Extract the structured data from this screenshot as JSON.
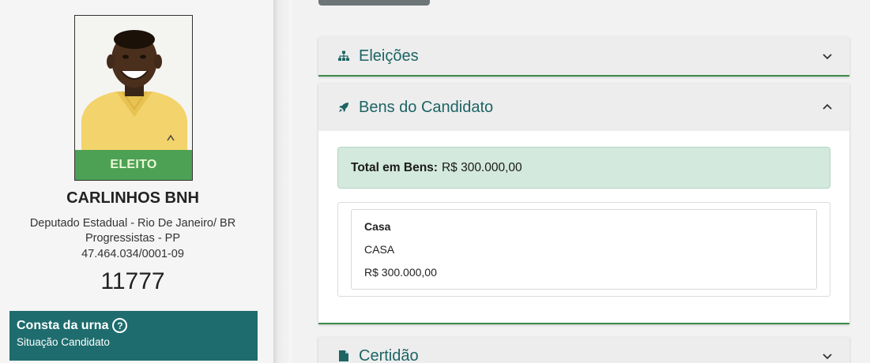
{
  "candidate": {
    "status": "ELEITO",
    "name": "CARLINHOS BNH",
    "role_location": "Deputado Estadual - Rio De Janeiro/ BR",
    "party": "Progressistas - PP",
    "cnpj": "47.464.034/0001-09",
    "number": "11777"
  },
  "urna": {
    "title": "Consta da urna",
    "subtitle": "Situação Candidato"
  },
  "sections": {
    "eleicoes": {
      "title": "Eleições",
      "icon": "sitemap-icon",
      "expanded": false
    },
    "bens": {
      "title": "Bens do Candidato",
      "icon": "rocket-icon",
      "expanded": true,
      "total_label": "Total em Bens:",
      "total_value": "R$ 300.000,00",
      "items": [
        {
          "title": "Casa",
          "description": "CASA",
          "value": "R$ 300.000,00"
        }
      ]
    },
    "certidao": {
      "title": "Certidão",
      "icon": "file-icon",
      "expanded": false
    }
  },
  "colors": {
    "accent": "#1d6464",
    "elected": "#4ca155",
    "urna_bg": "#1e6c6e",
    "total_bg": "#d3e9dd"
  }
}
